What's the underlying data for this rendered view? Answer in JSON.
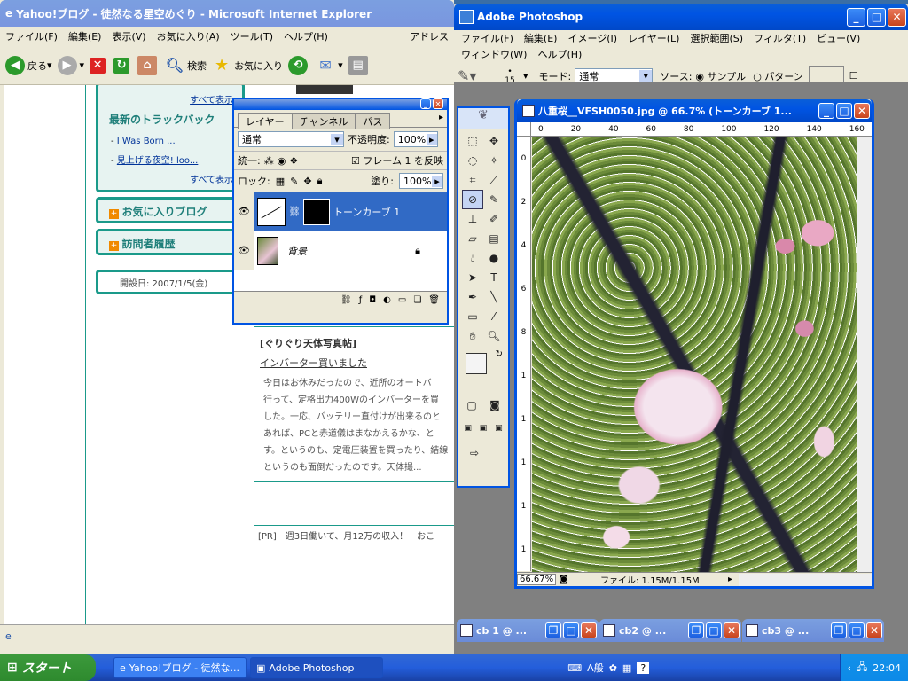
{
  "ie": {
    "title": "Yahoo!ブログ - 徒然なる星空めぐり - Microsoft Internet Explorer",
    "menus": [
      "ファイル(F)",
      "編集(E)",
      "表示(V)",
      "お気に入り(A)",
      "ツール(T)",
      "ヘルプ(H)"
    ],
    "address_label": "アドレス",
    "toolbar": {
      "back": "戻る",
      "search": "検索",
      "favorites": "お気に入り"
    },
    "sidebar": {
      "see_all_1": "すべて表示",
      "trackback_title": "最新のトラックバック",
      "trackbacks": [
        "I Was Born ...",
        "見上げる夜空! loo..."
      ],
      "see_all_2": "すべて表示",
      "fav_blog": "お気に入りブログ",
      "visitor": "訪問者履歴",
      "opened": "開設日: 2007/1/5(金)"
    },
    "post": {
      "category": "[ぐりぐり天体写真帖]",
      "title": "インバーター買いました",
      "body": [
        "今日はお休みだったので、近所のオートバ",
        "行って、定格出力400Wのインバーターを買",
        "した。一応、バッテリー直付けが出来るのと",
        "あれば、PCと赤道儀はまなかえるかな、と",
        "す。というのも、定電圧装置を買ったり、結線",
        "というのも面倒だったのです。天体撮..."
      ],
      "pr": "[PR]　週3日働いて、月12万の収入！　おこ"
    }
  },
  "ps": {
    "title": "Adobe Photoshop",
    "menus": [
      "ファイル(F)",
      "編集(E)",
      "イメージ(I)",
      "レイヤー(L)",
      "選択範囲(S)",
      "フィルタ(T)",
      "ビュー(V)",
      "ウィンドウ(W)",
      "ヘルプ(H)"
    ],
    "options": {
      "brush_size": "15",
      "mode_label": "モード:",
      "mode_value": "通常",
      "source_label": "ソース:",
      "sample": "サンプル",
      "pattern": "パターン"
    },
    "layers": {
      "tabs": [
        "レイヤー",
        "チャンネル",
        "パス"
      ],
      "blend": "通常",
      "opacity_label": "不透明度:",
      "opacity": "100%",
      "unify_label": "統一:",
      "frame_label": "フレーム 1 を反映",
      "lock_label": "ロック:",
      "fill_label": "塗り:",
      "fill": "100%",
      "items": [
        {
          "name": "トーンカーブ 1"
        },
        {
          "name": "背景"
        }
      ]
    },
    "image": {
      "title": "八重桜__VFSH0050.jpg @ 66.7% (トーンカーブ 1...",
      "ruler_h": [
        "0",
        "20",
        "40",
        "60",
        "80",
        "100",
        "120",
        "140",
        "160"
      ],
      "ruler_v": [
        "0",
        "2",
        "4",
        "6",
        "8",
        "1",
        "1",
        "1",
        "1",
        "1"
      ],
      "zoom": "66.67%",
      "file_info": "ファイル: 1.15M/1.15M"
    },
    "minimized": [
      "cb 1 @ ...",
      "cb2 @ ...",
      "cb3 @ ..."
    ]
  },
  "taskbar": {
    "start": "スタート",
    "tasks": [
      "Yahoo!ブログ - 徒然な...",
      "Adobe Photoshop"
    ],
    "tray_ime": "A般",
    "clock": "22:04"
  },
  "colors": {
    "xp_blue": "#0054e3",
    "teal": "#1a9a8a",
    "desktop": "#3a6ea5"
  }
}
